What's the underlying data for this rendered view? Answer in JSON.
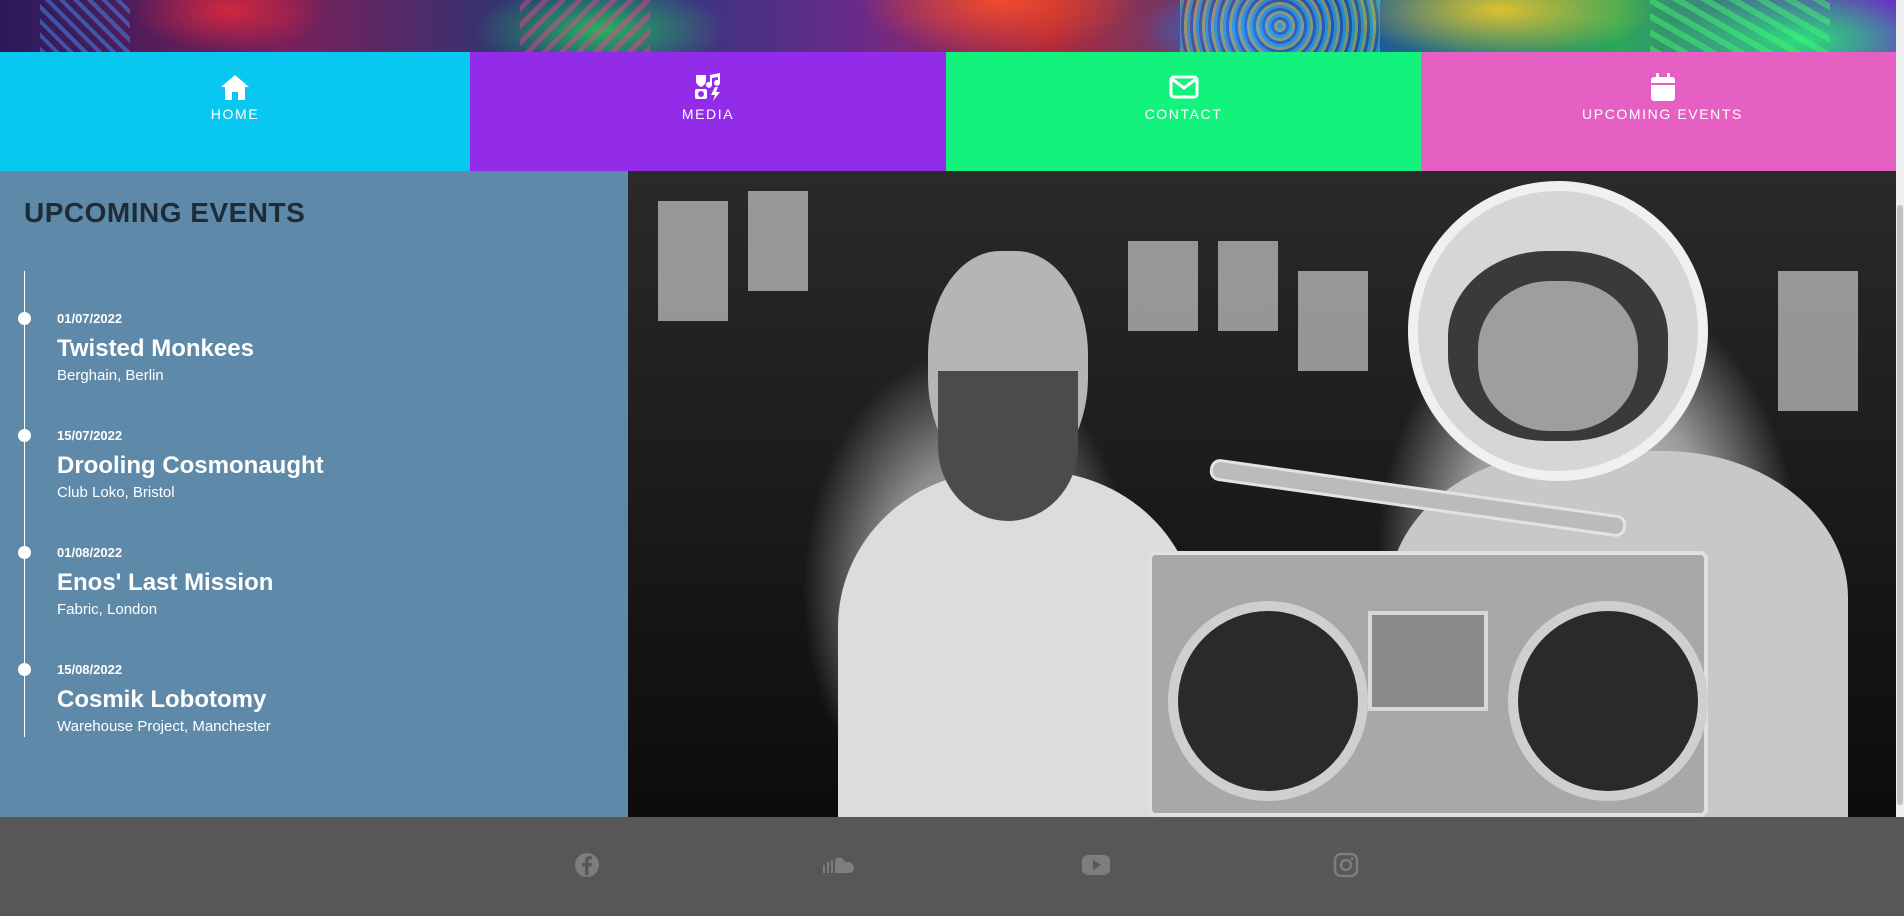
{
  "nav": {
    "items": [
      {
        "label": "HOME",
        "icon": "home-icon",
        "color": "#08c8f2"
      },
      {
        "label": "MEDIA",
        "icon": "media-icon",
        "color": "#922ce8"
      },
      {
        "label": "CONTACT",
        "icon": "envelope-icon",
        "color": "#14f27e"
      },
      {
        "label": "UPCOMING EVENTS",
        "icon": "calendar-icon",
        "color": "#e65fc3"
      }
    ]
  },
  "sidebar": {
    "title": "UPCOMING EVENTS",
    "background": "#5f89a8",
    "events": [
      {
        "date": "01/07/2022",
        "name": "Twisted Monkees",
        "venue": "Berghain, Berlin"
      },
      {
        "date": "15/07/2022",
        "name": "Drooling Cosmonaught",
        "venue": "Club Loko, Bristol"
      },
      {
        "date": "01/08/2022",
        "name": "Enos' Last Mission",
        "venue": "Fabric, London"
      },
      {
        "date": "15/08/2022",
        "name": "Cosmik Lobotomy",
        "venue": "Warehouse Project, Manchester"
      }
    ]
  },
  "footer": {
    "background": "#575757",
    "social": [
      {
        "icon": "facebook-icon"
      },
      {
        "icon": "soundcloud-icon"
      },
      {
        "icon": "youtube-icon"
      },
      {
        "icon": "instagram-icon"
      }
    ]
  }
}
